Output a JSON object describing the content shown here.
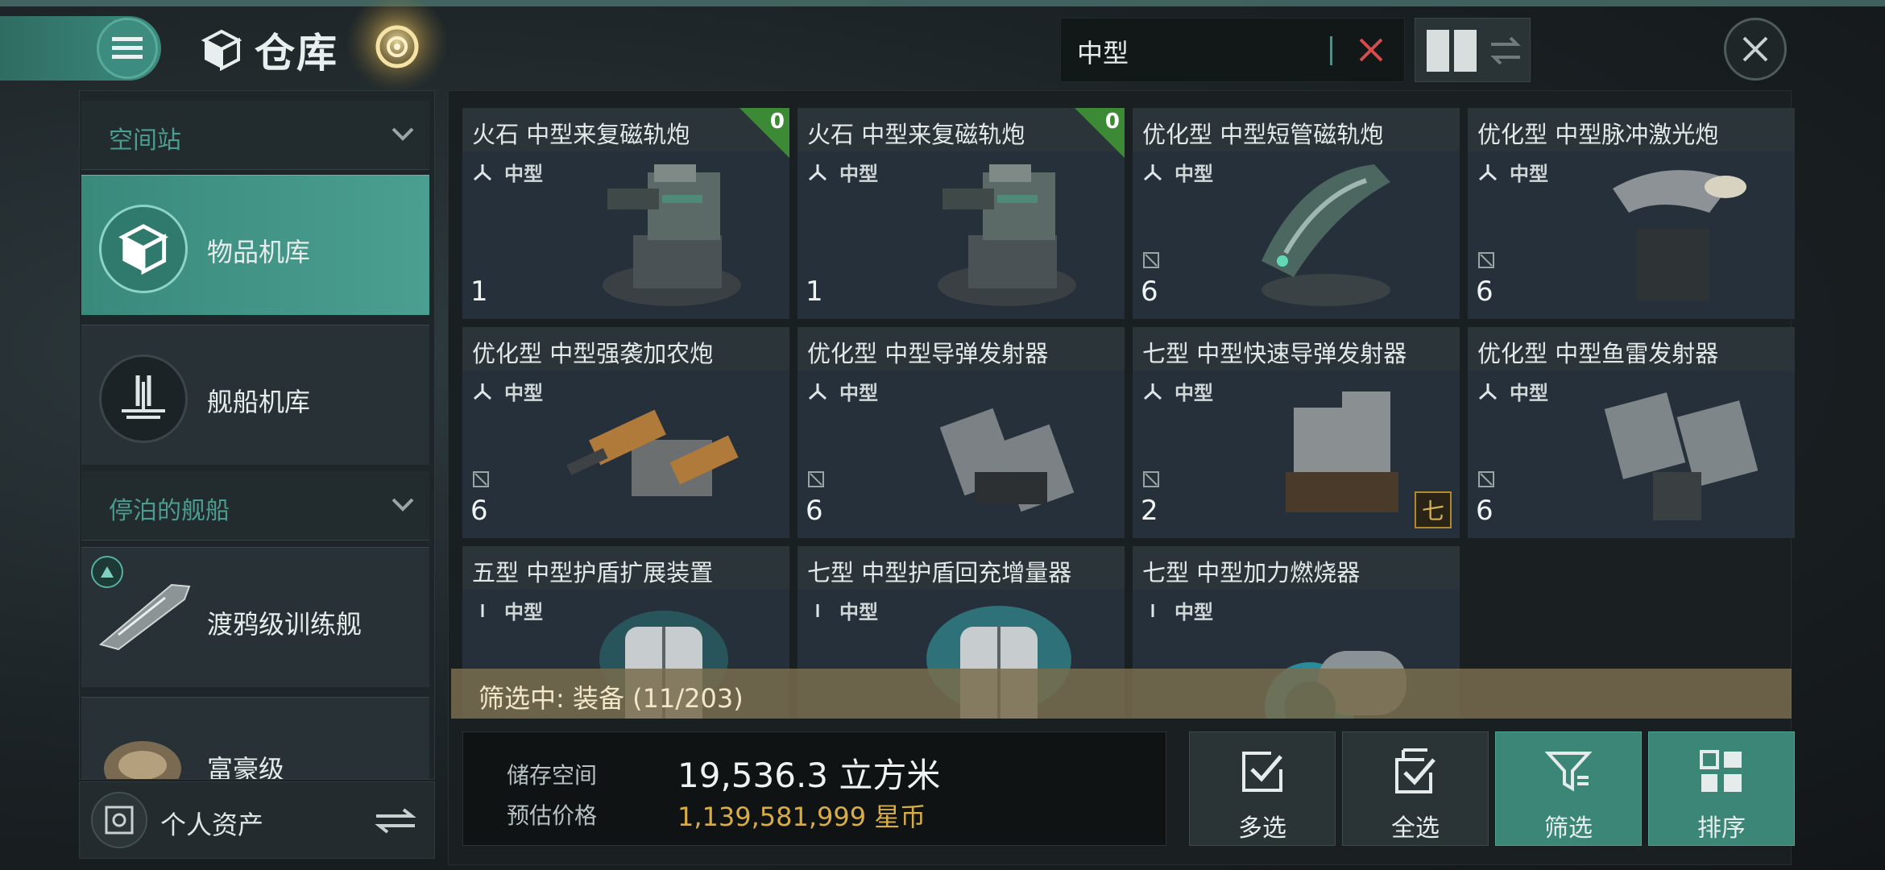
{
  "header": {
    "title": "仓库",
    "search": {
      "value": "中型"
    }
  },
  "sidebar": {
    "sections": [
      {
        "label": "空间站"
      },
      {
        "label": "停泊的舰船"
      }
    ],
    "items": [
      {
        "label": "物品机库",
        "icon": "cube-icon",
        "active": true
      },
      {
        "label": "舰船机库",
        "icon": "ship-hangar-icon",
        "active": false
      },
      {
        "label": "渡鸦级训练舰",
        "icon": "ship-icon",
        "active": false
      },
      {
        "label": "富豪级",
        "icon": "ship-icon",
        "active": false
      }
    ],
    "assets_label": "个人资产"
  },
  "items": [
    {
      "name": "火石 中型来复磁轨炮",
      "size": "中型",
      "qty": "1",
      "corner": "0"
    },
    {
      "name": "火石 中型来复磁轨炮",
      "size": "中型",
      "qty": "1",
      "corner": "0"
    },
    {
      "name": "优化型 中型短管磁轨炮",
      "size": "中型",
      "qty": "6"
    },
    {
      "name": "优化型 中型脉冲激光炮",
      "size": "中型",
      "qty": "6"
    },
    {
      "name": "优化型 中型强袭加农炮",
      "size": "中型",
      "qty": "6"
    },
    {
      "name": "优化型 中型导弹发射器",
      "size": "中型",
      "qty": "6"
    },
    {
      "name": "七型 中型快速导弹发射器",
      "size": "中型",
      "qty": "2",
      "tier": "七"
    },
    {
      "name": "优化型 中型鱼雷发射器",
      "size": "中型",
      "qty": "6"
    },
    {
      "name": "五型 中型护盾扩展装置",
      "size": "中型"
    },
    {
      "name": "七型 中型护盾回充增量器",
      "size": "中型"
    },
    {
      "name": "七型 中型加力燃烧器",
      "size": "中型"
    }
  ],
  "filter_status": "筛选中: 装备 (11/203)",
  "stats": {
    "storage_label": "储存空间",
    "storage_value": "19,536.3 立方米",
    "price_label": "预估价格",
    "price_value": "1,139,581,999 星币"
  },
  "actions": [
    {
      "label": "多选"
    },
    {
      "label": "全选"
    },
    {
      "label": "筛选"
    },
    {
      "label": "排序"
    }
  ],
  "colors": {
    "accent": "#3b8677",
    "gold": "#d8ad46",
    "corner_green": "#3d8a36"
  }
}
